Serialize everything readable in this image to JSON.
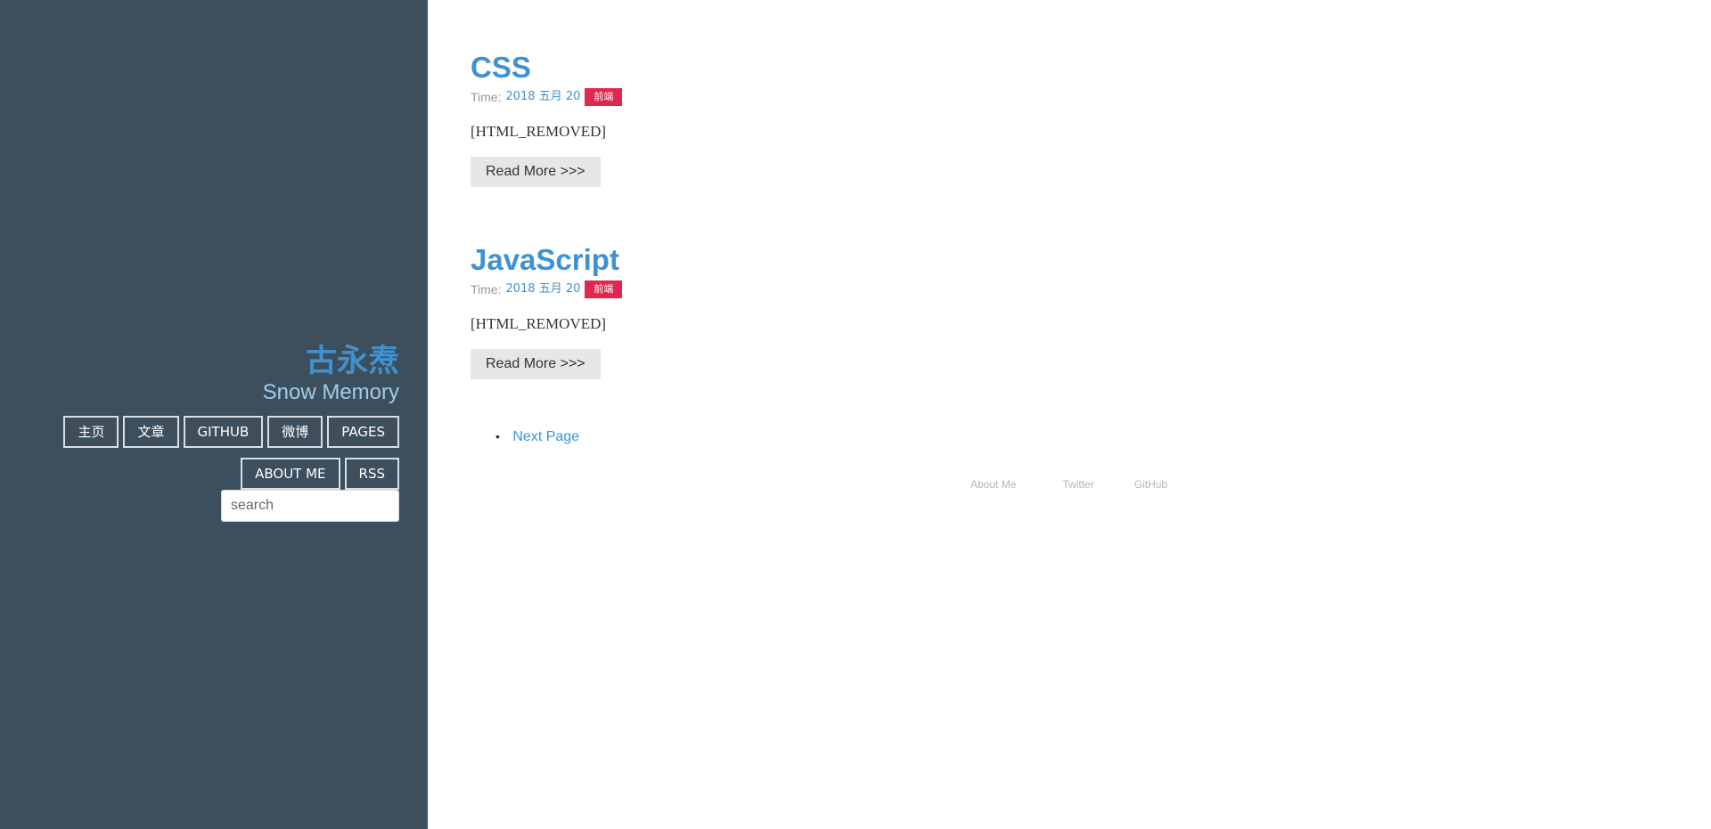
{
  "sidebar": {
    "brand_name": "古永焘",
    "brand_sub": "Snow Memory",
    "nav": [
      {
        "label": "主页"
      },
      {
        "label": "文章"
      },
      {
        "label": "GITHUB"
      },
      {
        "label": "微博"
      },
      {
        "label": "PAGES"
      },
      {
        "label": "ABOUT ME"
      },
      {
        "label": "RSS"
      }
    ],
    "search_placeholder": "search"
  },
  "posts": [
    {
      "title": "CSS",
      "time_label": "Time:",
      "date": "2018 五月 20",
      "tag": "前端",
      "excerpt": "[HTML_REMOVED]",
      "read_more": "Read More >>>"
    },
    {
      "title": "JavaScript",
      "time_label": "Time:",
      "date": "2018 五月 20",
      "tag": "前端",
      "excerpt": "[HTML_REMOVED]",
      "read_more": "Read More >>>"
    }
  ],
  "pager": {
    "bullet": "•",
    "next": "Next Page"
  },
  "footer": {
    "links": [
      "About Me",
      "Twitter",
      "GitHub"
    ]
  },
  "colors": {
    "sidebar_bg": "#3d4f5d",
    "accent": "#3f92cf",
    "tag_bg": "#e0284f"
  }
}
